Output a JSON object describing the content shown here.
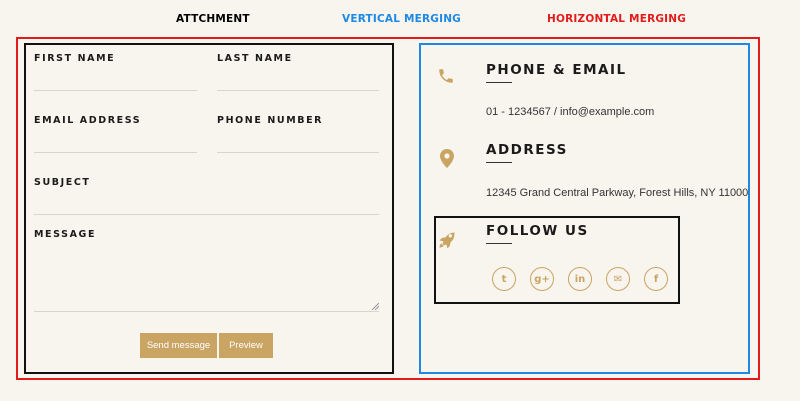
{
  "labels": {
    "attachment": "ATTCHMENT",
    "vertical": "VERTICAL MERGING",
    "horizontal": "HORIZONTAL MERGING"
  },
  "form": {
    "first_name": "FIRST NAME",
    "last_name": "LAST NAME",
    "email": "EMAIL ADDRESS",
    "phone": "PHONE NUMBER",
    "subject": "SUBJECT",
    "message": "MESSAGE",
    "send_label": "Send message",
    "preview_label": "Preview"
  },
  "info": {
    "phone_email": {
      "heading": "PHONE & EMAIL",
      "text": "01 - 1234567 / info@example.com",
      "icon": "phone-icon"
    },
    "address": {
      "heading": "ADDRESS",
      "text": "12345 Grand Central Parkway, Forest Hills, NY 11000",
      "icon": "map-pin-icon"
    },
    "follow": {
      "heading": "FOLLOW US",
      "icon": "rocket-icon",
      "social": [
        {
          "name": "twitter-icon",
          "glyph": "t"
        },
        {
          "name": "google-plus-icon",
          "glyph": "g+"
        },
        {
          "name": "linkedin-icon",
          "glyph": "in"
        },
        {
          "name": "email-icon",
          "glyph": "✉"
        },
        {
          "name": "facebook-icon",
          "glyph": "f"
        }
      ]
    }
  },
  "colors": {
    "accent": "#c9a463",
    "background": "#f8f5ef",
    "red_border": "#e31b1b",
    "blue_border": "#1e88e5",
    "black_border": "#111111"
  }
}
